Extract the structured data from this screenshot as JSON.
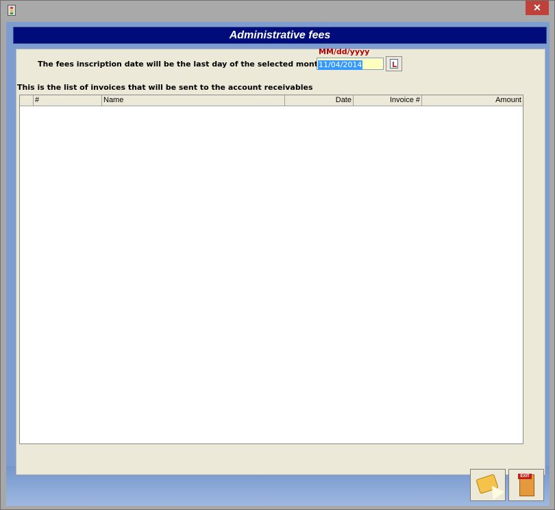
{
  "window": {
    "close_glyph": "✕"
  },
  "header": {
    "title": "Administrative fees"
  },
  "date_section": {
    "caption": "The fees inscription date will be the last day of the selected month",
    "format_hint": "MM/dd/yyyy",
    "value": "11/04/2014",
    "calendar_icon": "calendar-icon"
  },
  "invoice_list": {
    "caption": "This is the list of invoices that will be sent to the account receivables",
    "columns": [
      "",
      "#",
      "Name",
      "Date",
      "Invoice #",
      "Amount"
    ],
    "rows": []
  },
  "footer": {
    "ok_icon": "confirm-icon",
    "exit_icon": "exit-door-icon",
    "exit_sign": "EXIT"
  },
  "colors": {
    "header_band": "#000c7a",
    "panel": "#ece9d8",
    "date_input_bg": "#ffffc0",
    "format_hint": "#b30000"
  }
}
